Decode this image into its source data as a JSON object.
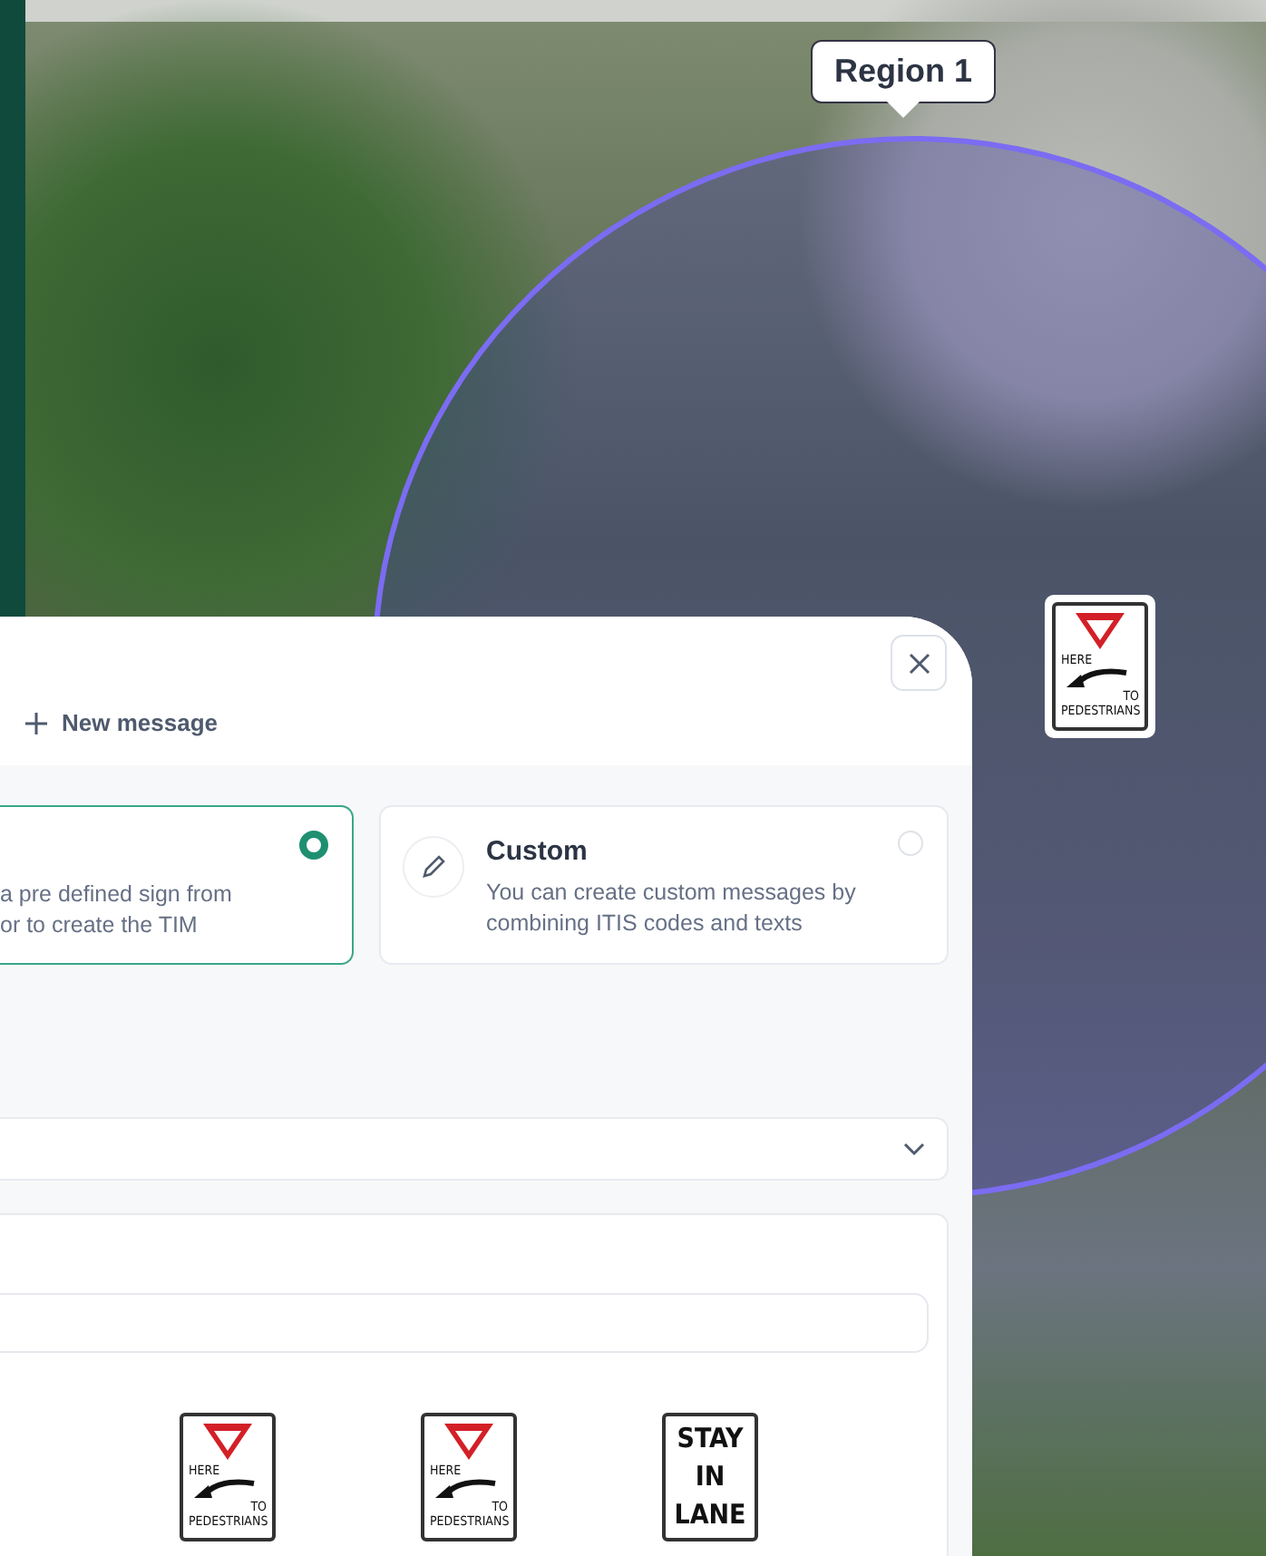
{
  "map": {
    "region": {
      "label": "Region 1"
    },
    "marker": {
      "kind": "yield_pedestrians",
      "lines": [
        "HERE",
        "TO",
        "PEDESTRIANS"
      ]
    }
  },
  "panel": {
    "new_message": "New message",
    "options": [
      {
        "kind": "predefined",
        "selected": true,
        "description": [
          "a pre defined sign from",
          "or to create the TIM"
        ]
      },
      {
        "kind": "custom",
        "selected": false,
        "title": "Custom",
        "description": [
          "You can create custom messages by",
          "combining ITIS codes and texts"
        ]
      }
    ],
    "signs": [
      {
        "kind": "yield_pedestrians",
        "lines": [
          "HERE",
          "TO",
          "PEDESTRIANS"
        ]
      },
      {
        "kind": "yield_pedestrians",
        "lines": [
          "HERE",
          "TO",
          "PEDESTRIANS"
        ]
      },
      {
        "kind": "text",
        "lines": [
          "STAY",
          "IN",
          "LANE"
        ]
      }
    ]
  }
}
